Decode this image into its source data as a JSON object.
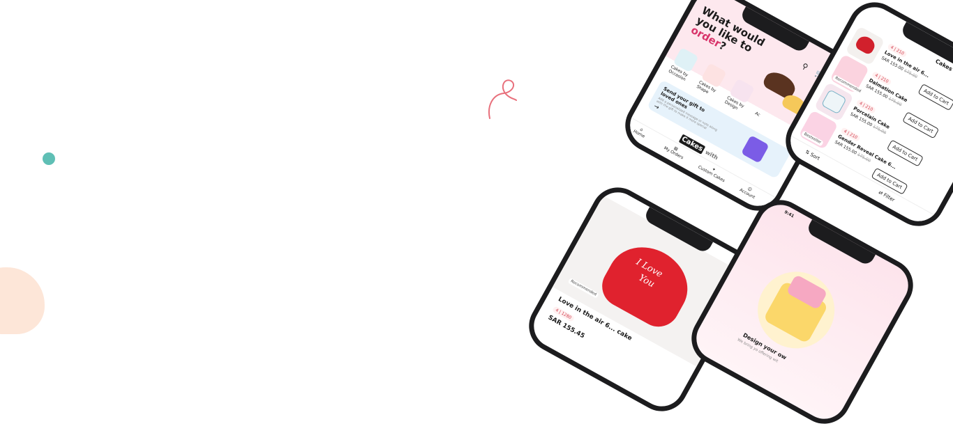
{
  "colors": {
    "accent": "#d8346a",
    "teal": "#5fbfb5",
    "peach": "#fde6d8",
    "pink_bg": "#fde8ee"
  },
  "home": {
    "heading_line1": "What would",
    "heading_line2": "you like to",
    "heading_accent": "order",
    "heading_end": "?",
    "icons": [
      "search-icon",
      "cart-icon"
    ],
    "categories": [
      "Cakes by Occasion",
      "Cakes by Shape",
      "Cakes by Design",
      "Ac"
    ],
    "promo_title": "Send your gift to loved ones",
    "promo_text": "Add a personalized message or note along with the gift to make it more special",
    "logo_word1": "Cakes",
    "logo_word2": "with",
    "nav": [
      "Home",
      "My Orders",
      "Custom Cakes",
      "Account"
    ]
  },
  "listing": {
    "title": "Cakes with L",
    "items": [
      {
        "rating": "4 | 210",
        "name": "Love in the air 6...",
        "price": "SAR 155.00",
        "old_price": "175.00",
        "cta": "Add to Cart",
        "badge": ""
      },
      {
        "rating": "4 | 210",
        "name": "Dalmation Cake",
        "price": "SAR 155.00",
        "old_price": "175.00",
        "cta": "Add to Cart",
        "badge": "Recommended"
      },
      {
        "rating": "4 | 210",
        "name": "Porcelain Cake",
        "price": "SAR 155.00",
        "old_price": "175.00",
        "cta": "Add to Cart",
        "badge": ""
      },
      {
        "rating": "4 | 210",
        "name": "Gender Reveal Cake 6...",
        "price": "SAR 155.00",
        "old_price": "175.00",
        "cta": "Add to Cart",
        "badge": "Bestseller"
      }
    ],
    "sort_label": "Sort",
    "filter_label": "Filter"
  },
  "detail": {
    "cake_text_line1": "I Love",
    "cake_text_line2": "You",
    "badge": "Recommended",
    "rating": "4 | 1280",
    "name": "Love in the air 6... cake",
    "price": "SAR 155.45"
  },
  "custom": {
    "time": "9:41",
    "title": "Design your ow",
    "text": "We bring yo offering wit"
  }
}
